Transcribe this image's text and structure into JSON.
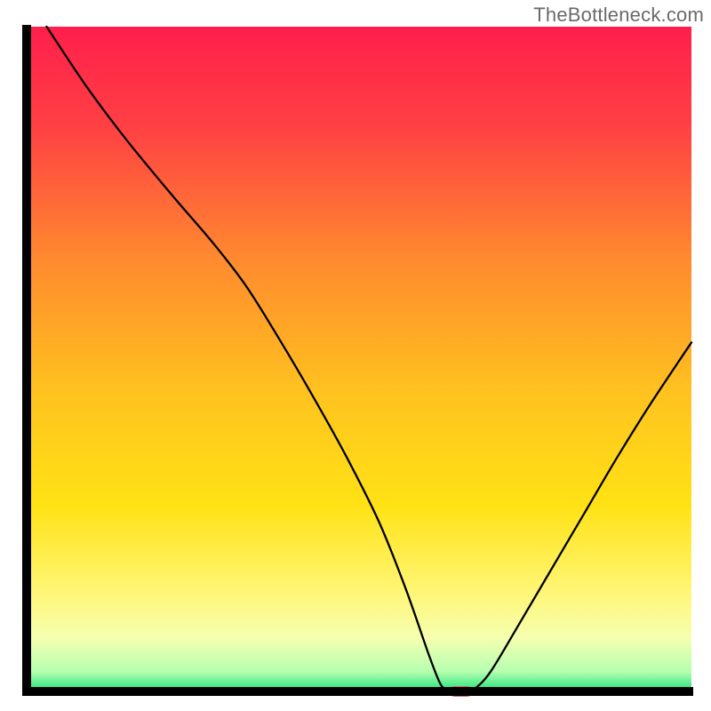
{
  "watermark": "TheBottleneck.com",
  "colors": {
    "curve_stroke": "#000000",
    "axis_stroke": "#000000",
    "marker_fill": "#e06666",
    "marker_stroke": "#d04848",
    "gradient": [
      {
        "offset": 0.0,
        "color": "#ff1f4c"
      },
      {
        "offset": 0.15,
        "color": "#ff4044"
      },
      {
        "offset": 0.35,
        "color": "#ff8a2f"
      },
      {
        "offset": 0.55,
        "color": "#ffc21f"
      },
      {
        "offset": 0.72,
        "color": "#ffe215"
      },
      {
        "offset": 0.85,
        "color": "#fff676"
      },
      {
        "offset": 0.92,
        "color": "#f5ffb0"
      },
      {
        "offset": 0.97,
        "color": "#b6ffb0"
      },
      {
        "offset": 1.0,
        "color": "#1fe27a"
      }
    ]
  },
  "chart_data": {
    "type": "line",
    "title": "",
    "xlabel": "",
    "ylabel": "",
    "xlim": [
      0,
      100
    ],
    "ylim": [
      0,
      100
    ],
    "marker": {
      "x": 65.3,
      "y": 0
    },
    "curve": [
      {
        "x": 3.0,
        "y": 100.0
      },
      {
        "x": 9.0,
        "y": 91.0
      },
      {
        "x": 15.0,
        "y": 83.0
      },
      {
        "x": 22.0,
        "y": 74.5
      },
      {
        "x": 28.0,
        "y": 67.5
      },
      {
        "x": 33.0,
        "y": 61.0
      },
      {
        "x": 38.0,
        "y": 53.0
      },
      {
        "x": 43.0,
        "y": 44.5
      },
      {
        "x": 48.0,
        "y": 35.5
      },
      {
        "x": 53.0,
        "y": 25.5
      },
      {
        "x": 57.0,
        "y": 15.5
      },
      {
        "x": 60.5,
        "y": 5.5
      },
      {
        "x": 62.2,
        "y": 1.2
      },
      {
        "x": 63.2,
        "y": 0.3
      },
      {
        "x": 64.5,
        "y": 0.0
      },
      {
        "x": 66.2,
        "y": 0.0
      },
      {
        "x": 67.4,
        "y": 0.4
      },
      {
        "x": 69.8,
        "y": 3.0
      },
      {
        "x": 74.0,
        "y": 10.0
      },
      {
        "x": 79.0,
        "y": 18.5
      },
      {
        "x": 84.0,
        "y": 27.0
      },
      {
        "x": 89.0,
        "y": 35.5
      },
      {
        "x": 94.0,
        "y": 43.5
      },
      {
        "x": 100.0,
        "y": 52.5
      }
    ]
  }
}
